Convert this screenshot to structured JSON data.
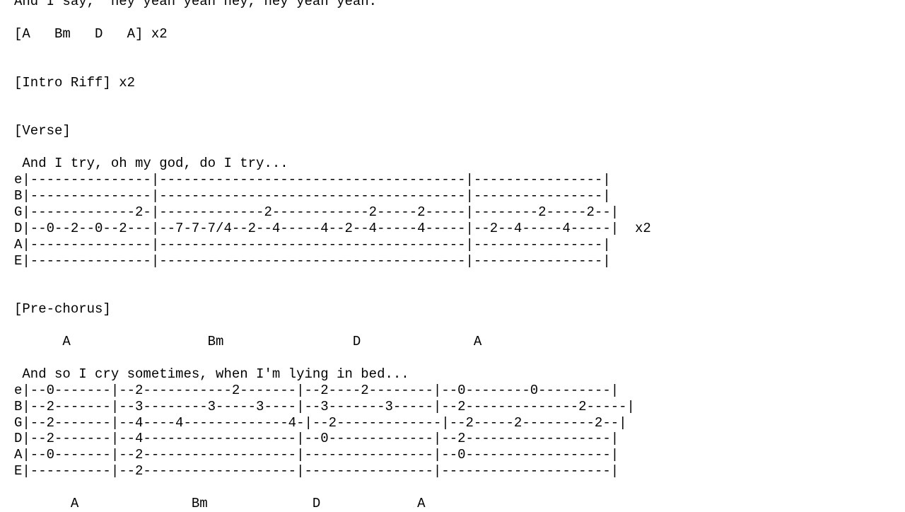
{
  "document": {
    "type": "guitar-tablature",
    "background_color": "#ffffff",
    "text_color": "#000000",
    "font_style": "monospace"
  },
  "lines": [
    "And I say, \"hey yeah yeah hey, hey yeah yeah.",
    "",
    "[A   Bm   D   A] x2",
    "",
    "",
    "[Intro Riff] x2",
    "",
    "",
    "[Verse]",
    "",
    " And I try, oh my god, do I try...",
    "e|---------------|--------------------------------------|----------------|",
    "B|---------------|--------------------------------------|----------------|",
    "G|-------------2-|-------------2------------2-----2-----|--------2-----2--|",
    "D|--0--2--0--2---|--7-7-7/4--2--4-----4--2--4-----4-----|--2--4-----4-----|  x2",
    "A|---------------|--------------------------------------|----------------|",
    "E|---------------|--------------------------------------|----------------|",
    "",
    "",
    "[Pre-chorus]",
    "",
    "      A                 Bm                D              A",
    "",
    " And so I cry sometimes, when I'm lying in bed...",
    "e|--0-------|--2-----------2-------|--2----2--------|--0--------0---------|",
    "B|--2-------|--3--------3-----3----|--3-------3-----|--2--------------2-----|",
    "G|--2-------|--4----4-------------4-|--2-------------|--2-----2---------2--|",
    "D|--2-------|--4-------------------|--0-------------|--2------------------|",
    "A|--0-------|--2-------------------|----------------|--0------------------|",
    "E|----------|--2-------------------|----------------|---------------------|",
    "",
    "       A              Bm             D            A"
  ],
  "sections": {
    "intro_chords": "[A   Bm   D   A] x2",
    "intro_riff": "[Intro Riff] x2",
    "verse_label": "[Verse]",
    "verse_lyric": " And I try, oh my god, do I try...",
    "verse_repeat": "x2",
    "prechorus_label": "[Pre-chorus]",
    "prechorus_chords_top": "      A                 Bm                D              A",
    "prechorus_lyric": " And so I cry sometimes, when I'm lying in bed...",
    "prechorus_chords_bottom": "       A              Bm             D            A",
    "cut_top_lyric": "And I say, \"hey yeah yeah hey, hey yeah yeah."
  },
  "string_labels": [
    "e",
    "B",
    "G",
    "D",
    "A",
    "E"
  ],
  "chords": [
    "A",
    "Bm",
    "D",
    "A"
  ]
}
